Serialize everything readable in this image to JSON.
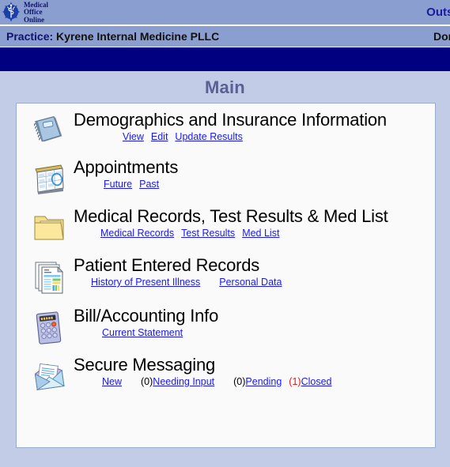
{
  "header": {
    "logo": {
      "icon": "caduceus-star-logo",
      "line1": "Medical",
      "line2": "Office",
      "line3": "Online"
    },
    "outside_label": "Outside",
    "practice_label": "Practice:",
    "practice_name": "Kyrene Internal Medicine PLLC",
    "user_name": "Dorette"
  },
  "page": {
    "title": "Main"
  },
  "sections": [
    {
      "key": "demographics",
      "icon": "notebook-icon",
      "title": "Demographics and Insurance Information",
      "links": [
        {
          "label": "View"
        },
        {
          "label": "Edit"
        },
        {
          "label": "Update Results"
        }
      ]
    },
    {
      "key": "appointments",
      "icon": "calendar-icon",
      "title": "Appointments",
      "links": [
        {
          "label": "Future"
        },
        {
          "label": "Past"
        }
      ]
    },
    {
      "key": "records",
      "icon": "folder-icon",
      "title": "Medical Records, Test Results & Med List",
      "links": [
        {
          "label": "Medical Records"
        },
        {
          "label": "Test Results"
        },
        {
          "label": "Med List"
        }
      ]
    },
    {
      "key": "patient_entered_records",
      "icon": "documents-icon",
      "title": "Patient Entered Records",
      "links": [
        {
          "label": "History of Present Illness"
        },
        {
          "label": "Personal Data"
        }
      ]
    },
    {
      "key": "bill",
      "icon": "calculator-icon",
      "title": "Bill/Accounting Info",
      "links": [
        {
          "label": "Current Statement"
        }
      ]
    },
    {
      "key": "secure_messaging",
      "icon": "envelope-icon",
      "title": "Secure Messaging",
      "links": [
        {
          "label": "New",
          "count": ""
        },
        {
          "label": "Needing Input",
          "count": "(0)",
          "count_color": "normal"
        },
        {
          "label": "Pending",
          "count": "(0)",
          "count_color": "normal"
        },
        {
          "label": "Closed",
          "count": "(1)",
          "count_color": "alert"
        }
      ]
    }
  ],
  "colors": {
    "band": "#8b9ed0",
    "navy_bar": "#000080",
    "page_background": "#c3cce7",
    "panel_background": "#fafafa",
    "link": "#1a1aee",
    "alert": "#e01b1b",
    "title": "#5a5f94"
  }
}
